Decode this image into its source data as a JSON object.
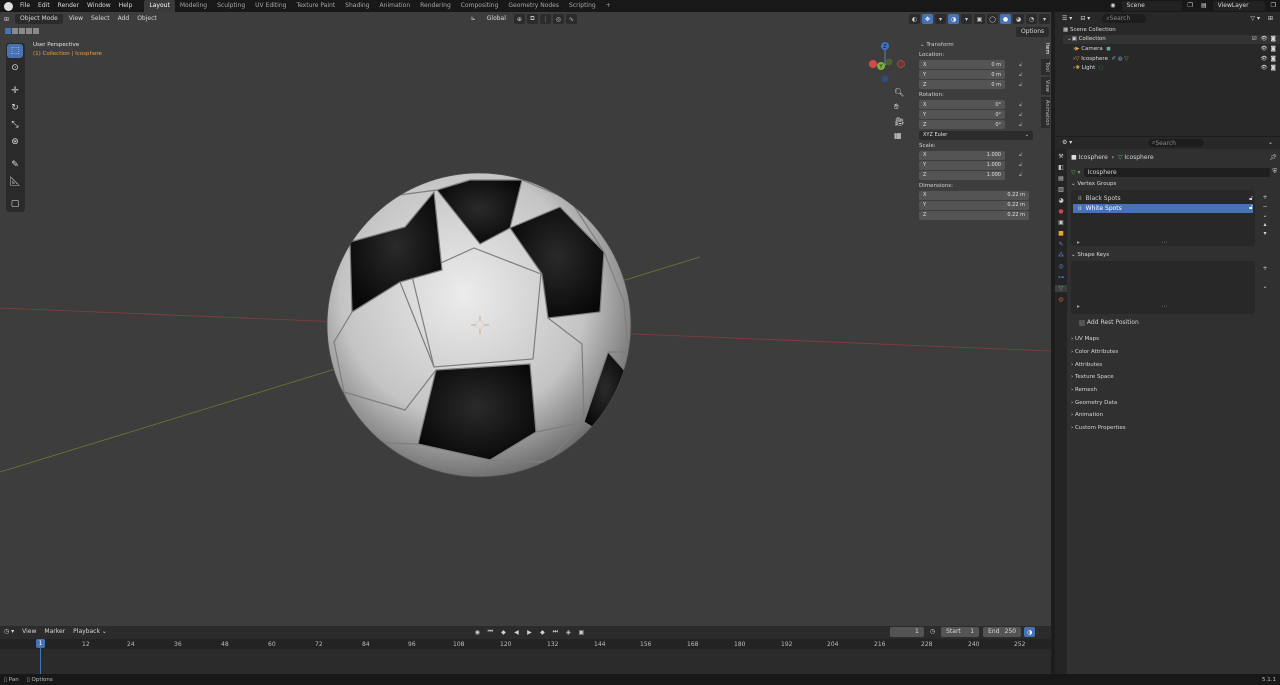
{
  "menu": {
    "file": "File",
    "edit": "Edit",
    "render": "Render",
    "window": "Window",
    "help": "Help"
  },
  "workspaces": [
    "Layout",
    "Modeling",
    "Sculpting",
    "UV Editing",
    "Texture Paint",
    "Shading",
    "Animation",
    "Rendering",
    "Compositing",
    "Geometry Nodes",
    "Scripting"
  ],
  "top_right": {
    "scene": "Scene",
    "view_layer": "ViewLayer"
  },
  "viewport": {
    "mode": "Object Mode",
    "view": "View",
    "select": "Select",
    "add": "Add",
    "object": "Object",
    "orientation": "Global",
    "options": "Options",
    "overlay_title": "User Perspective",
    "overlay_sub": "(1) Collection | Icosphere"
  },
  "gizmo": {
    "x": "X",
    "y": "Y",
    "z": "Z"
  },
  "n_panel": {
    "title": "Transform",
    "location_label": "Location:",
    "location": [
      {
        "axis": "X",
        "value": "0 m"
      },
      {
        "axis": "Y",
        "value": "0 m"
      },
      {
        "axis": "Z",
        "value": "0 m"
      }
    ],
    "rotation_label": "Rotation:",
    "rotation": [
      {
        "axis": "X",
        "value": "0°"
      },
      {
        "axis": "Y",
        "value": "0°"
      },
      {
        "axis": "Z",
        "value": "0°"
      }
    ],
    "rotation_mode": "XYZ Euler",
    "scale_label": "Scale:",
    "scale": [
      {
        "axis": "X",
        "value": "1.000"
      },
      {
        "axis": "Y",
        "value": "1.000"
      },
      {
        "axis": "Z",
        "value": "1.000"
      }
    ],
    "dimensions_label": "Dimensions:",
    "dimensions": [
      {
        "axis": "X",
        "value": "0.22 m"
      },
      {
        "axis": "Y",
        "value": "0.22 m"
      },
      {
        "axis": "Z",
        "value": "0.22 m"
      }
    ],
    "tabs": [
      "Item",
      "Tool",
      "View",
      "Animation"
    ]
  },
  "timeline": {
    "view": "View",
    "marker": "Marker",
    "playback": "Playback",
    "current_frame": "1",
    "start_label": "Start",
    "start": "1",
    "end_label": "End",
    "end": "250",
    "ticks": [
      "12",
      "24",
      "36",
      "48",
      "60",
      "72",
      "84",
      "96",
      "108",
      "120",
      "132",
      "144",
      "156",
      "168",
      "180",
      "192",
      "204",
      "216",
      "228",
      "240",
      "252"
    ],
    "playhead": "1"
  },
  "outliner": {
    "search_placeholder": "Search",
    "scene_collection": "Scene Collection",
    "collection": "Collection",
    "items": [
      "Camera",
      "Icosphere",
      "Light"
    ]
  },
  "properties": {
    "search_placeholder": "Search",
    "breadcrumb_object": "Icosphere",
    "breadcrumb_data": "Icosphere",
    "mesh_name": "Icosphere",
    "vertex_groups_title": "Vertex Groups",
    "vertex_groups": [
      "Black Spots",
      "White Spots"
    ],
    "shape_keys_title": "Shape Keys",
    "add_rest_position": "Add Rest Position",
    "panels": [
      "UV Maps",
      "Color Attributes",
      "Attributes",
      "Texture Space",
      "Remesh",
      "Geometry Data",
      "Animation",
      "Custom Properties"
    ]
  },
  "status": {
    "pan": "Pan",
    "options": "Options",
    "version": "5.1.1"
  },
  "colors": {
    "accent": "#4772b3",
    "active_orange": "#e8a23c",
    "viewport_bg": "#3d3d3d"
  }
}
